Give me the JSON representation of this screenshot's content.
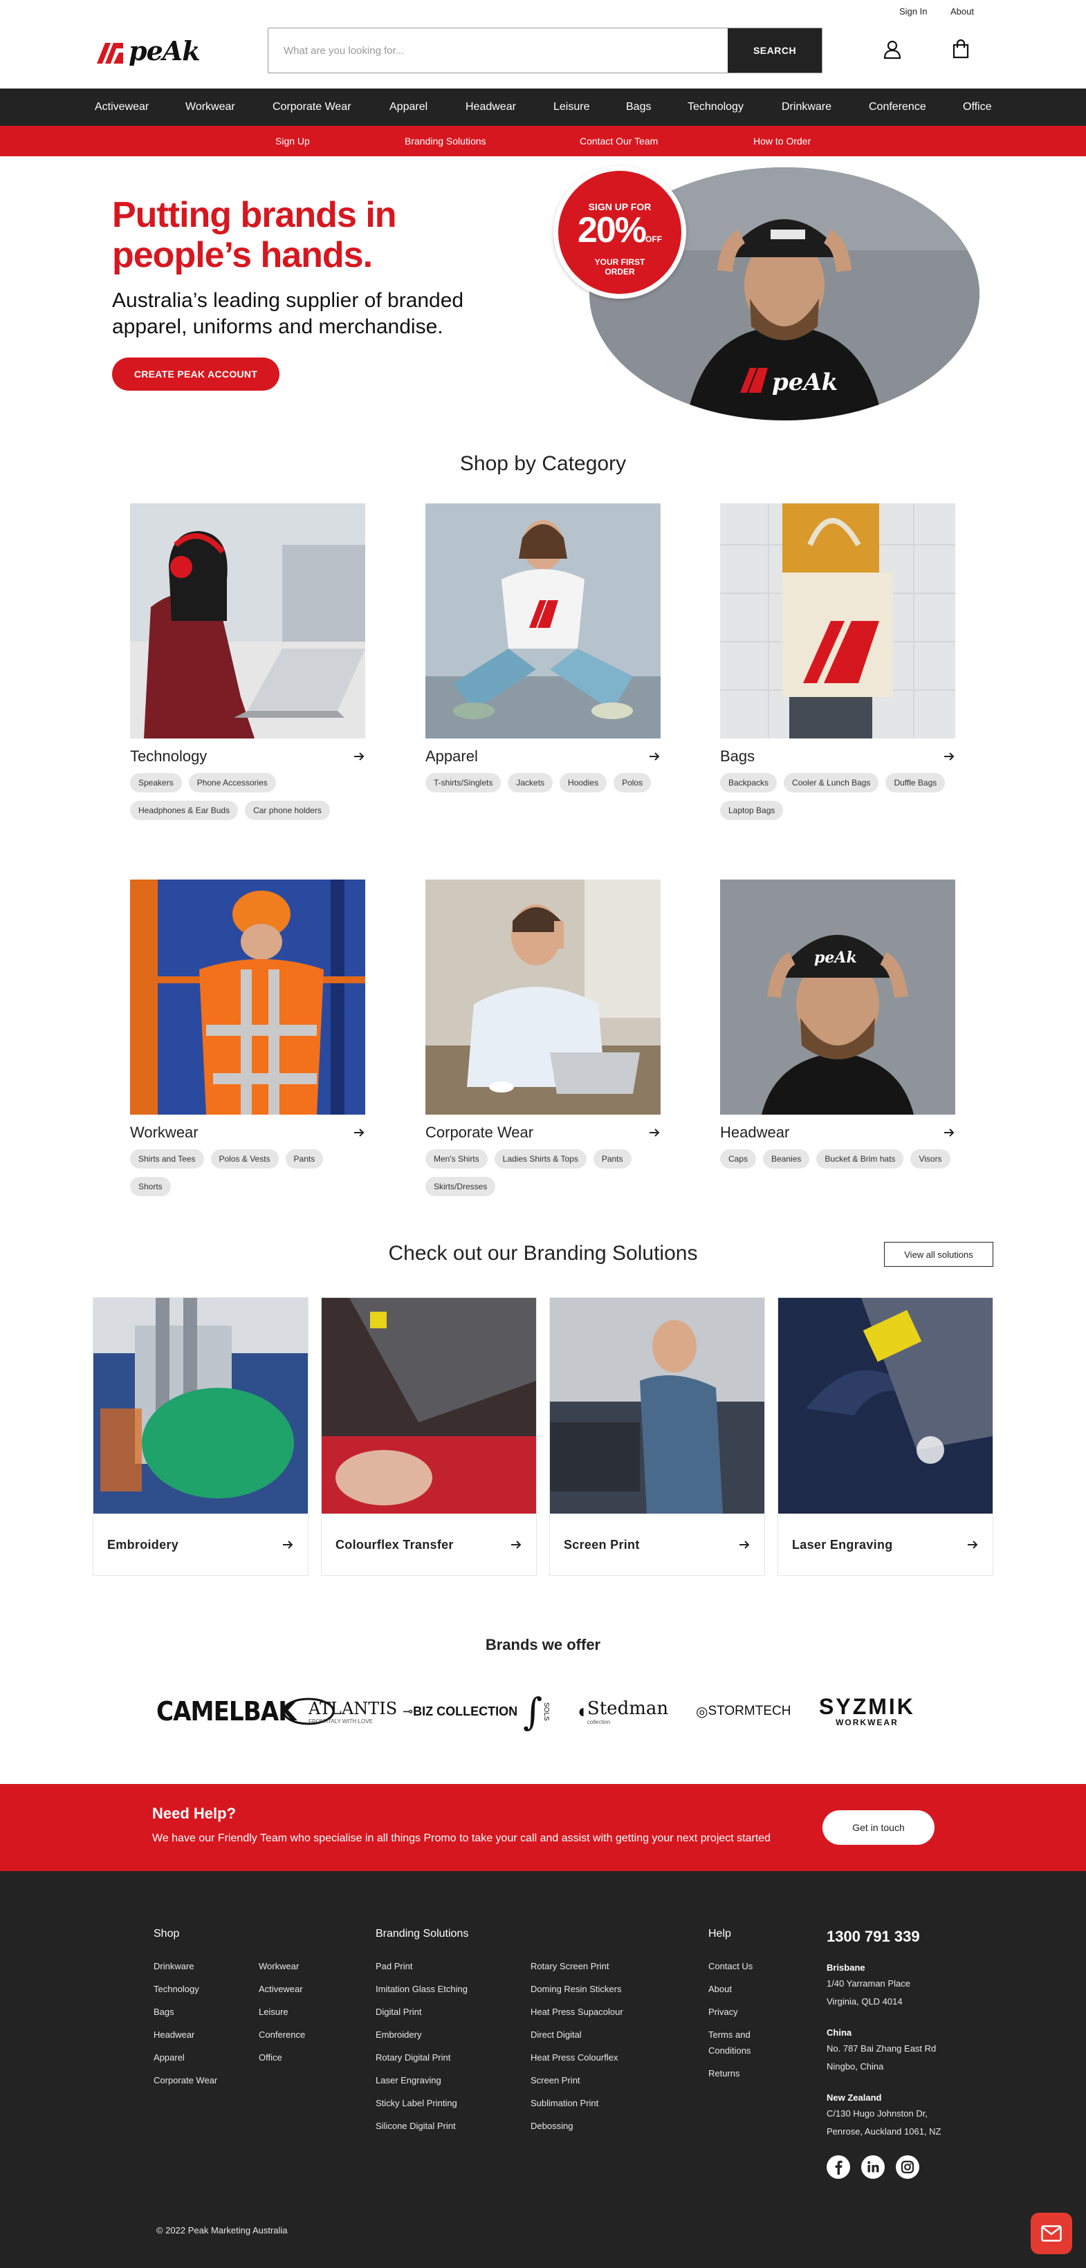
{
  "utility": {
    "sign_in": "Sign In",
    "about": "About"
  },
  "brand": {
    "logo_text": "peAk"
  },
  "search": {
    "placeholder": "What are you looking for...",
    "button": "SEARCH"
  },
  "main_nav": [
    "Activewear",
    "Workwear",
    "Corporate Wear",
    "Apparel",
    "Headwear",
    "Leisure",
    "Bags",
    "Technology",
    "Drinkware",
    "Conference",
    "Office"
  ],
  "sub_nav": [
    "Sign Up",
    "Branding Solutions",
    "Contact Our Team",
    "How to Order"
  ],
  "hero": {
    "headline": "Putting brands in people’s hands.",
    "subheadline": "Australia’s leading supplier of branded apparel, uniforms and merchandise.",
    "cta": "CREATE PEAK ACCOUNT",
    "badge_line1": "SIGN UP FOR",
    "badge_percent": "20%",
    "badge_off": "OFF",
    "badge_line3": "YOUR FIRST",
    "badge_line4": "ORDER"
  },
  "categories": {
    "title": "Shop by Category",
    "items": [
      {
        "name": "Technology",
        "tags": [
          "Speakers",
          "Phone Accessories",
          "Headphones & Ear Buds",
          "Car phone holders"
        ]
      },
      {
        "name": "Apparel",
        "tags": [
          "T-shirts/Singlets",
          "Jackets",
          "Hoodies",
          "Polos"
        ]
      },
      {
        "name": "Bags",
        "tags": [
          "Backpacks",
          "Cooler & Lunch Bags",
          "Duffle Bags",
          "Laptop Bags"
        ]
      },
      {
        "name": "Workwear",
        "tags": [
          "Shirts and Tees",
          "Polos & Vests",
          "Pants",
          "Shorts"
        ]
      },
      {
        "name": "Corporate Wear",
        "tags": [
          "Men's Shirts",
          "Ladies Shirts & Tops",
          "Pants",
          "Skirts/Dresses"
        ]
      },
      {
        "name": "Headwear",
        "tags": [
          "Caps",
          "Beanies",
          "Bucket & Brim hats",
          "Visors"
        ]
      }
    ]
  },
  "branding": {
    "title": "Check out our Branding Solutions",
    "view_all": "View all solutions",
    "items": [
      "Embroidery",
      "Colourflex Transfer",
      "Screen Print",
      "Laser Engraving"
    ]
  },
  "brands": {
    "title": "Brands we offer",
    "logos": [
      "CAMELBAK",
      "ATLANTIS",
      "BIZ COLLECTION",
      "SOLS",
      "Stedman",
      "STORMTECH",
      "SYZMIK",
      "WORKWEAR",
      "FROM ITALY WITH LOVE",
      "collection"
    ]
  },
  "help": {
    "title": "Need Help?",
    "text": "We have our Friendly Team who specialise in all things Promo to take your call and assist with getting your next project started",
    "button": "Get in touch"
  },
  "footer": {
    "shop_title": "Shop",
    "shop_col1": [
      "Drinkware",
      "Technology",
      "Bags",
      "Headwear",
      "Apparel",
      "Corporate Wear"
    ],
    "shop_col2": [
      "Workwear",
      "Activewear",
      "Leisure",
      "Conference",
      "Office"
    ],
    "branding_title": "Branding Solutions",
    "branding_col1": [
      "Pad Print",
      "Imitation Glass Etching",
      "Digital Print",
      "Embroidery",
      "Rotary Digital Print",
      "Laser Engraving",
      "Sticky Label Printing",
      "Silicone Digital Print"
    ],
    "branding_col2": [
      "Rotary Screen Print",
      "Doming Resin Stickers",
      "Heat Press Supacolour",
      "Direct Digital",
      "Heat Press Colourflex",
      "Screen Print",
      "Sublimation Print",
      "Debossing"
    ],
    "help_title": "Help",
    "help_links": [
      "Contact Us",
      "About",
      "Privacy",
      "Terms and",
      "Conditions",
      "Returns"
    ],
    "phone": "1300 791 339",
    "offices": [
      {
        "city": "Brisbane",
        "line1": "1/40 Yarraman Place",
        "line2": "Virginia, QLD 4014"
      },
      {
        "city": "China",
        "line1": "No. 787 Bai Zhang East Rd",
        "line2": "Ningbo, China"
      },
      {
        "city": "New Zealand",
        "line1": "C/130 Hugo Johnston Dr,",
        "line2": "Penrose, Auckland 1061, NZ"
      }
    ],
    "social": [
      "facebook-icon",
      "linkedin-icon",
      "instagram-icon"
    ],
    "copyright": "© 2022 Peak Marketing Australia"
  },
  "colors": {
    "brand_red": "#d7171f",
    "dark": "#232323",
    "tag_bg": "#e6e6e6"
  }
}
